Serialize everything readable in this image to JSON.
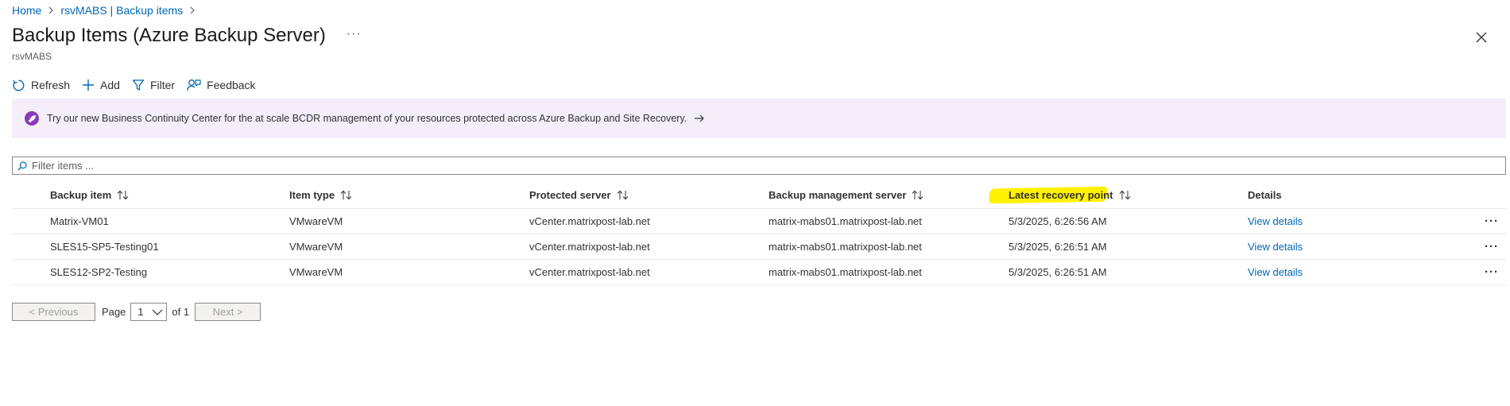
{
  "breadcrumb": {
    "items": [
      "Home",
      "rsvMABS | Backup items"
    ]
  },
  "header": {
    "title": "Backup Items (Azure Backup Server)",
    "more": "···",
    "subtitle": "rsvMABS"
  },
  "toolbar": {
    "refresh": "Refresh",
    "add": "Add",
    "filter": "Filter",
    "feedback": "Feedback"
  },
  "banner": {
    "text": "Try our new Business Continuity Center for the at scale BCDR management of your resources protected across Azure Backup and Site Recovery.",
    "icon": "rocket-icon",
    "accent": "#8a3ab9",
    "background": "#f4eefa"
  },
  "filter": {
    "placeholder": "Filter items ...",
    "value": ""
  },
  "table": {
    "columns": [
      "Backup item",
      "Item type",
      "Protected server",
      "Backup management server",
      "Latest recovery point",
      "Details"
    ],
    "rows": [
      {
        "item": "Matrix-VM01",
        "type": "VMwareVM",
        "protected": "vCenter.matrixpost-lab.net",
        "mgmt": "matrix-mabs01.matrixpost-lab.net",
        "recovery": "5/3/2025, 6:26:56 AM",
        "details": "View details"
      },
      {
        "item": "SLES15-SP5-Testing01",
        "type": "VMwareVM",
        "protected": "vCenter.matrixpost-lab.net",
        "mgmt": "matrix-mabs01.matrixpost-lab.net",
        "recovery": "5/3/2025, 6:26:51 AM",
        "details": "View details"
      },
      {
        "item": "SLES12-SP2-Testing",
        "type": "VMwareVM",
        "protected": "vCenter.matrixpost-lab.net",
        "mgmt": "matrix-mabs01.matrixpost-lab.net",
        "recovery": "5/3/2025, 6:26:51 AM",
        "details": "View details"
      }
    ],
    "row_more": "···",
    "highlight_color": "#fff100"
  },
  "pager": {
    "prev": "< Previous",
    "page_label": "Page",
    "current": "1",
    "of": "of 1",
    "next": "Next >"
  },
  "colors": {
    "link": "#0067b8",
    "text": "#323130"
  }
}
